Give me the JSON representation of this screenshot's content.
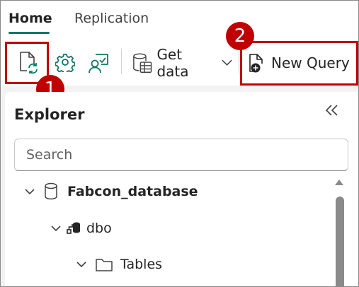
{
  "tabs": {
    "home": "Home",
    "replication": "Replication"
  },
  "toolbar": {
    "get_data_label": "Get data",
    "new_query_label": "New Query"
  },
  "badges": {
    "first": "1",
    "second": "2"
  },
  "explorer": {
    "title": "Explorer",
    "search_placeholder": "Search",
    "tree": {
      "database": "Fabcon_database",
      "schema": "dbo",
      "folder": "Tables"
    }
  },
  "colors": {
    "accent": "#117865",
    "highlight": "#c00000"
  }
}
